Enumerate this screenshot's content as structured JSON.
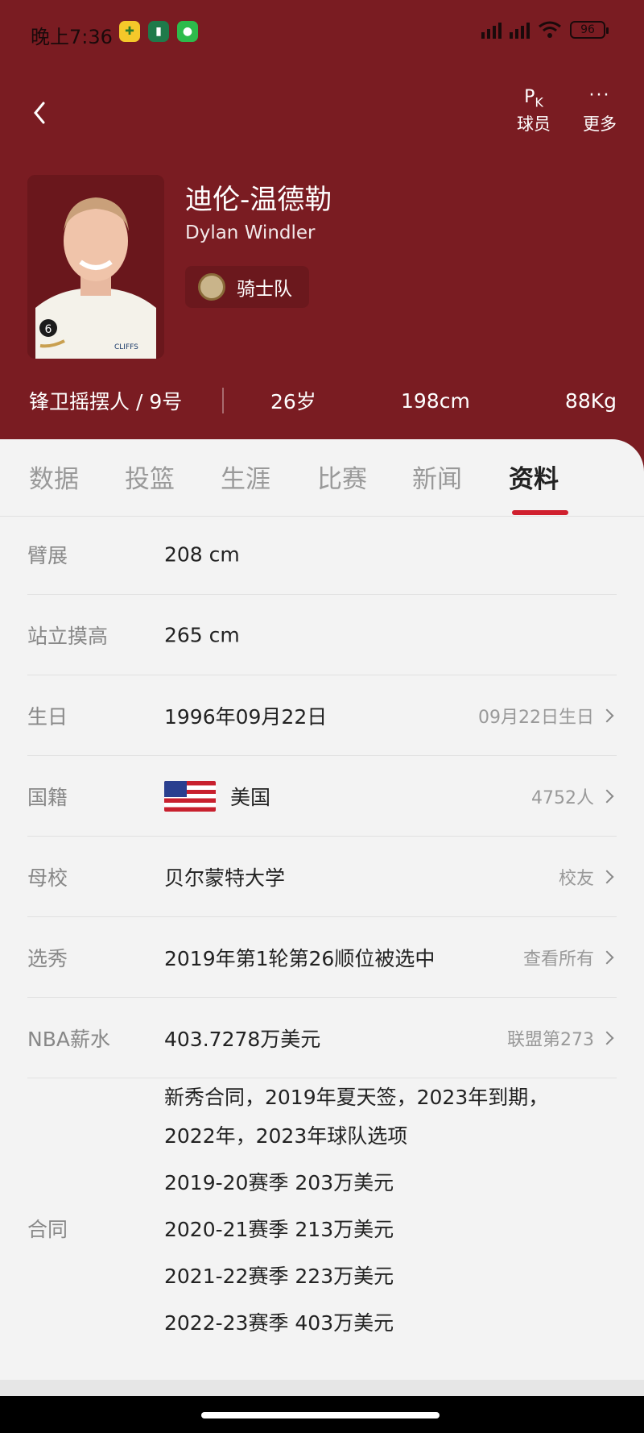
{
  "status_bar": {
    "time": "晚上7:36",
    "battery": "96"
  },
  "nav": {
    "back_label": "",
    "pk_label": "球员",
    "more_label": "更多",
    "pk_icon_text": "PK"
  },
  "player": {
    "name_cn": "迪伦-温德勒",
    "name_en": "Dylan Windler",
    "team": "骑士队",
    "position_number": "锋卫摇摆人 / 9号",
    "age": "26岁",
    "height": "198cm",
    "weight": "88Kg"
  },
  "tabs": [
    "数据",
    "投篮",
    "生涯",
    "比赛",
    "新闻",
    "资料"
  ],
  "active_tab": "资料",
  "info": {
    "wingspan": {
      "label": "臂展",
      "value": "208 cm"
    },
    "reach": {
      "label": "站立摸高",
      "value": "265 cm"
    },
    "birthday": {
      "label": "生日",
      "value": "1996年09月22日",
      "extra": "09月22日生日"
    },
    "nationality": {
      "label": "国籍",
      "value": "美国",
      "extra": "4752人"
    },
    "school": {
      "label": "母校",
      "value": "贝尔蒙特大学",
      "extra": "校友"
    },
    "draft": {
      "label": "选秀",
      "value": "2019年第1轮第26顺位被选中",
      "extra": "查看所有"
    },
    "salary": {
      "label": "NBA薪水",
      "value": "403.7278万美元",
      "extra": "联盟第273"
    }
  },
  "contract": {
    "label": "合同",
    "lines": [
      "新秀合同，2019年夏天签，2023年到期，",
      "2022年，2023年球队选项",
      "2019-20赛季 203万美元",
      "2020-21赛季 213万美元",
      "2021-22赛季 223万美元",
      "2022-23赛季 403万美元"
    ]
  },
  "colors": {
    "header": "#7a1c22",
    "accent": "#d0202e",
    "background": "#f3f3f3"
  }
}
